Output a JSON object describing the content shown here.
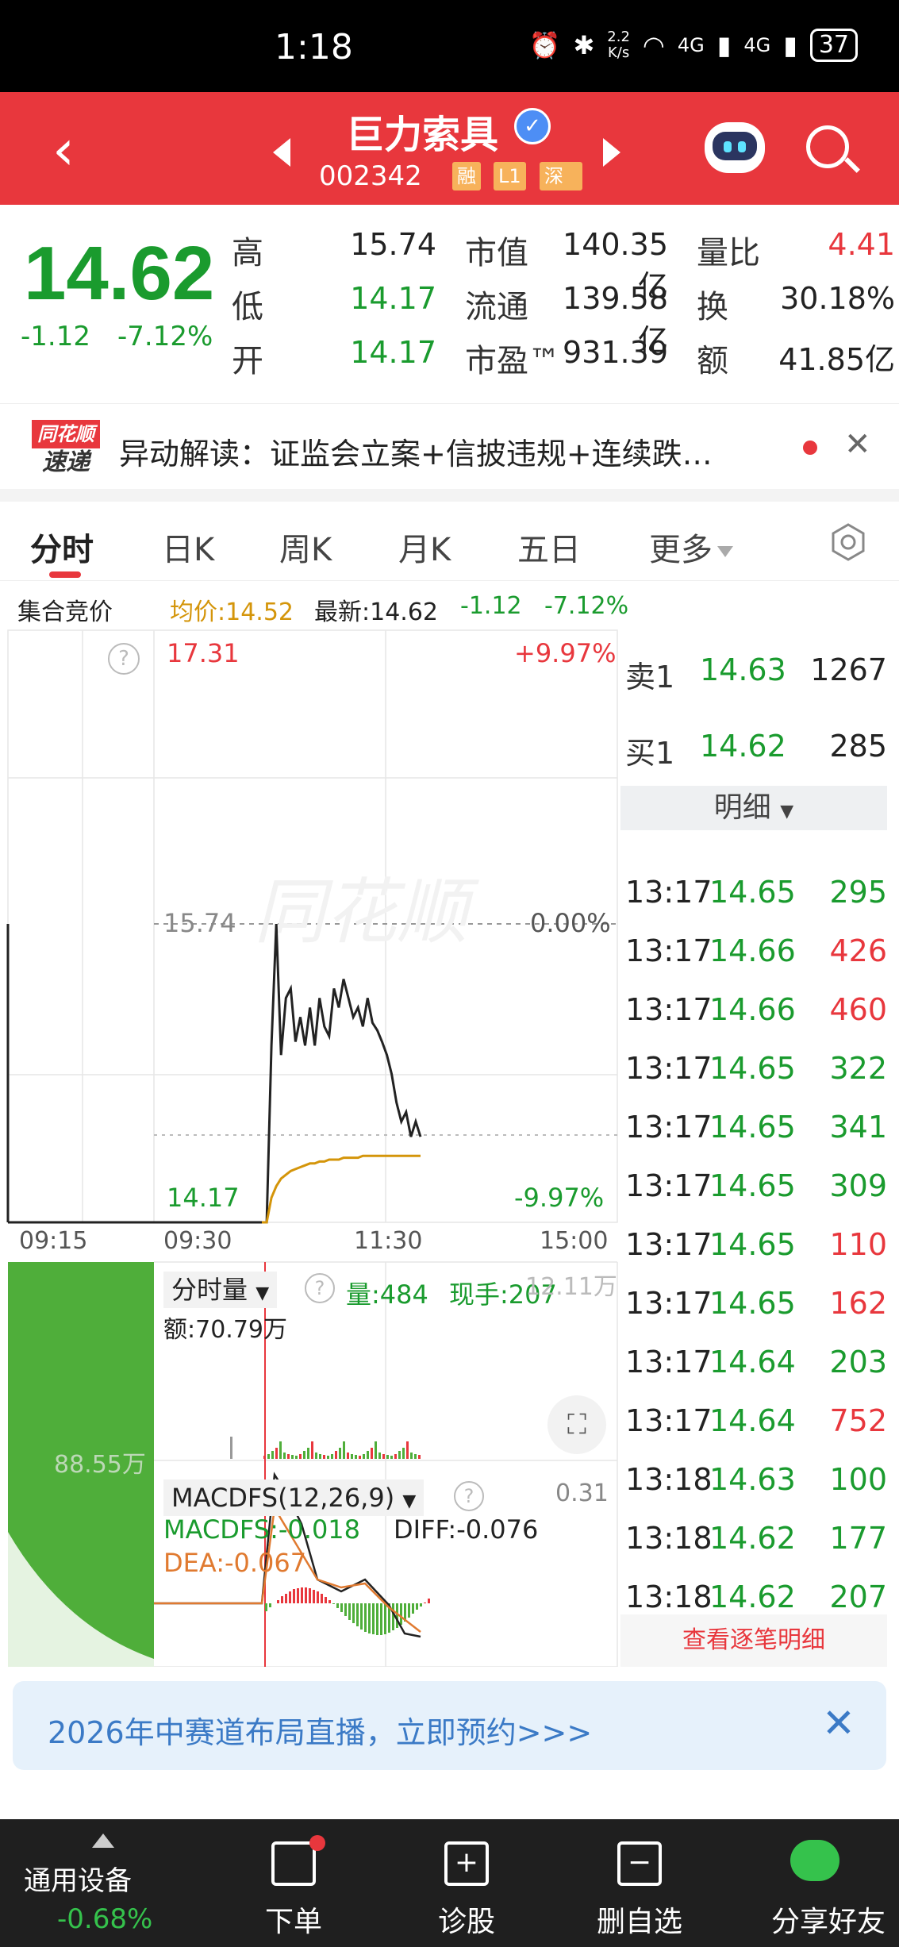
{
  "status_bar": {
    "time": "1:18",
    "speed_top": "2.2",
    "speed_bottom": "K/s",
    "battery": "37",
    "net1": "4G",
    "net2": "4G"
  },
  "header": {
    "stock_name": "巨力索具",
    "stock_code": "002342",
    "tags": [
      "融",
      "L1",
      "深股"
    ]
  },
  "quote": {
    "price": "14.62",
    "change": "-1.12",
    "change_pct": "-7.12%",
    "rows": [
      {
        "l1": "高",
        "v1": "15.74",
        "l2": "市值",
        "v2": "140.35亿",
        "l3": "量比",
        "v3": "4.41"
      },
      {
        "l1": "低",
        "v1": "14.17",
        "l2": "流通",
        "v2": "139.58亿",
        "l3": "换",
        "v3": "30.18%"
      },
      {
        "l1": "开",
        "v1": "14.17",
        "l2": "市盈™",
        "v2": "931.39",
        "l3": "额",
        "v3": "41.85亿"
      }
    ]
  },
  "news": {
    "logo_top": "同花顺",
    "logo_bottom": "速递",
    "text": "异动解读：证监会立案+信披违规+连续跌…",
    "close": "✕"
  },
  "tabs": [
    {
      "label": "分时",
      "active": true
    },
    {
      "label": "日K"
    },
    {
      "label": "周K"
    },
    {
      "label": "月K"
    },
    {
      "label": "五日"
    },
    {
      "label": "更多"
    }
  ],
  "info_line": {
    "auction": "集合竞价",
    "avg": "均价:14.52",
    "latest": "最新:14.62",
    "chg": "-1.12",
    "pct": "-7.12%"
  },
  "chart": {
    "top_price": "17.31",
    "top_pct": "+9.97%",
    "mid_price": "15.74",
    "mid_pct": "0.00%",
    "bot_price": "14.17",
    "bot_pct": "-9.97%",
    "time_labels": [
      "09:15",
      "09:30",
      "11:30",
      "15:00"
    ],
    "watermark": "同花顺",
    "vol_title": "分时量",
    "vol_val": "量:484",
    "vol_now": "现手:207",
    "vol_max": "12.11万",
    "vol_amt": "额:70.79万",
    "auction_vol": "88.55万",
    "macd_title": "MACDFS(12,26,9)",
    "macd_max": "0.31",
    "macd_val": "MACDFS:-0.018",
    "diff_val": "DIFF:-0.076",
    "dea_val": "DEA:-0.067"
  },
  "chart_data": {
    "type": "line",
    "title": "",
    "series": [
      {
        "values": [
          14.17,
          14.17,
          15.1,
          15.74,
          15.05,
          15.35,
          15.4,
          15.12,
          15.25,
          15.1,
          15.3,
          15.1,
          15.35,
          15.2,
          15.15,
          15.4,
          15.3,
          15.45,
          15.35,
          15.25,
          15.3,
          15.2,
          15.35,
          15.22,
          15.18,
          15.12,
          15.05,
          14.95,
          14.8,
          14.7,
          14.75,
          14.62,
          14.7,
          14.62
        ]
      },
      {
        "values": [
          14.17,
          14.17,
          14.3,
          14.36,
          14.4,
          14.42,
          14.44,
          14.45,
          14.46,
          14.47,
          14.48,
          14.48,
          14.49,
          14.49,
          14.5,
          14.5,
          14.5,
          14.51,
          14.51,
          14.51,
          14.51,
          14.52,
          14.52,
          14.52,
          14.52,
          14.52,
          14.52,
          14.52,
          14.52,
          14.52,
          14.52,
          14.52,
          14.52,
          14.52
        ]
      }
    ],
    "ylim": [
      14.17,
      17.31
    ]
  },
  "order_book": {
    "ask_label": "卖1",
    "ask_price": "14.63",
    "ask_vol": "1267",
    "bid_label": "买1",
    "bid_price": "14.62",
    "bid_vol": "285",
    "detail_label": "明细",
    "trades": [
      {
        "t": "13:17",
        "p": "14.65",
        "v": "295",
        "c": "green"
      },
      {
        "t": "13:17",
        "p": "14.66",
        "v": "426",
        "c": "red"
      },
      {
        "t": "13:17",
        "p": "14.66",
        "v": "460",
        "c": "red"
      },
      {
        "t": "13:17",
        "p": "14.65",
        "v": "322",
        "c": "green"
      },
      {
        "t": "13:17",
        "p": "14.65",
        "v": "341",
        "c": "green"
      },
      {
        "t": "13:17",
        "p": "14.65",
        "v": "309",
        "c": "green"
      },
      {
        "t": "13:17",
        "p": "14.65",
        "v": "110",
        "c": "red"
      },
      {
        "t": "13:17",
        "p": "14.65",
        "v": "162",
        "c": "red"
      },
      {
        "t": "13:17",
        "p": "14.64",
        "v": "203",
        "c": "green"
      },
      {
        "t": "13:17",
        "p": "14.64",
        "v": "752",
        "c": "red"
      },
      {
        "t": "13:18",
        "p": "14.63",
        "v": "100",
        "c": "green"
      },
      {
        "t": "13:18",
        "p": "14.62",
        "v": "177",
        "c": "green"
      },
      {
        "t": "13:18",
        "p": "14.62",
        "v": "207",
        "c": "green"
      }
    ],
    "view_all": "查看逐笔明细"
  },
  "banner": {
    "text": "2026年中赛道布局直播，立即预约>>>",
    "close": "✕"
  },
  "bottom_nav": {
    "index_name": "通用设备",
    "index_pct": "-0.68%",
    "items": [
      "下单",
      "诊股",
      "删自选",
      "分享好友"
    ]
  }
}
